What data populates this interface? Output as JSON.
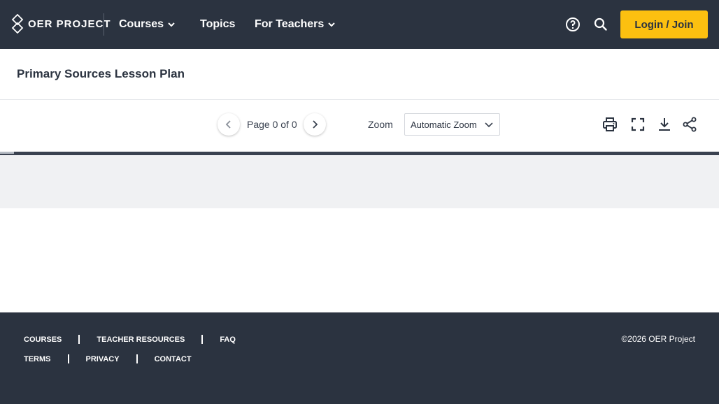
{
  "header": {
    "logo_text": "OER PROJECT",
    "nav": [
      {
        "label": "Courses",
        "has_dropdown": true
      },
      {
        "label": "Topics",
        "has_dropdown": false
      },
      {
        "label": "For Teachers",
        "has_dropdown": true
      }
    ],
    "login_label": "Login / Join",
    "icons": [
      "help-icon",
      "search-icon"
    ]
  },
  "page": {
    "title": "Primary Sources Lesson Plan"
  },
  "viewer": {
    "page_indicator": "Page 0 of 0",
    "zoom_label": "Zoom",
    "zoom_value": "Automatic Zoom",
    "tools": [
      "print-icon",
      "fullscreen-icon",
      "download-icon",
      "share-icon"
    ]
  },
  "footer": {
    "row1": [
      "COURSES",
      "TEACHER RESOURCES",
      "FAQ"
    ],
    "row2": [
      "TERMS",
      "PRIVACY",
      "CONTACT"
    ],
    "copyright": "©2026 OER Project"
  },
  "colors": {
    "nav_bg": "#2b3340",
    "accent": "#fcc010",
    "text": "#2b3340"
  }
}
